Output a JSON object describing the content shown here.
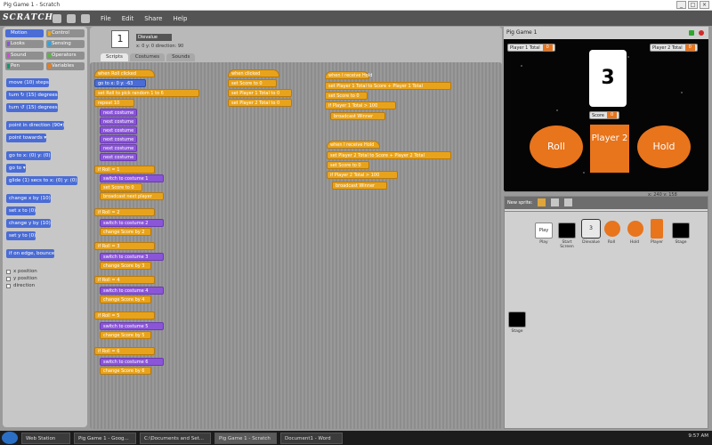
{
  "window": {
    "title": "Pig Game 1 - Scratch"
  },
  "menubar": {
    "logo": "SCRATCH",
    "items": [
      "File",
      "Edit",
      "Share",
      "Help"
    ]
  },
  "palette": {
    "categories": [
      {
        "label": "Motion",
        "color": "#4a6cd4"
      },
      {
        "label": "Control",
        "color": "#e8a31c"
      },
      {
        "label": "Looks",
        "color": "#8a55d7"
      },
      {
        "label": "Sensing",
        "color": "#2ca5e2"
      },
      {
        "label": "Sound",
        "color": "#cf4ad9"
      },
      {
        "label": "Operators",
        "color": "#5bb544"
      },
      {
        "label": "Pen",
        "color": "#0e9a6c"
      },
      {
        "label": "Variables",
        "color": "#ee7d16"
      }
    ],
    "blocks": [
      "move (10) steps",
      "turn ↻ (15) degrees",
      "turn ↺ (15) degrees",
      "point in direction (90▾)",
      "point towards ▾",
      "go to x: (0) y: (0)",
      "go to ▾",
      "glide (1) secs to x: (0) y: (0)",
      "change x by (10)",
      "set x to (0)",
      "change y by (10)",
      "set y to (0)",
      "if on edge, bounce"
    ],
    "checks": [
      "x position",
      "y position",
      "direction"
    ]
  },
  "sprite_header": {
    "number": "1",
    "name": "Dievalue",
    "info": "x: 0 y: 0 direction: 90"
  },
  "tabs": [
    "Scripts",
    "Costumes",
    "Sounds"
  ],
  "scripts": {
    "col1": [
      "when Roll clicked",
      "go to x: 0 y: -63",
      "set Roll to pick random 1 to 6",
      "repeat 10",
      "next costume",
      "next costume",
      "next costume",
      "next costume",
      "next costume",
      "next costume",
      "if Roll = 1",
      "switch to costume 1",
      "set Score to 0",
      "broadcast next player",
      "if Roll = 2",
      "switch to costume 2",
      "change Score by 2",
      "if Roll = 3",
      "switch to costume 3",
      "change Score by 3",
      "if Roll = 4",
      "switch to costume 4",
      "change Score by 4",
      "if Roll = 5",
      "switch to costume 5",
      "change Score by 5",
      "if Roll = 6",
      "switch to costume 6",
      "change Score by 6"
    ],
    "col2": [
      "when clicked",
      "set Score to 0",
      "set Player 1 Total to 0",
      "set Player 2 Total to 0"
    ],
    "col3": [
      "when I receive Hold",
      "set Player 1 Total to Score + Player 1 Total",
      "set Score to 0",
      "if Player 1 Total > 100",
      "broadcast Winner",
      "when I receive Hold",
      "set Player 2 Total to Score + Player 2 Total",
      "set Score to 0",
      "if Player 2 Total > 100",
      "broadcast Winner"
    ]
  },
  "stage": {
    "title": "Pig Game 1",
    "p1_label": "Player 1 Total",
    "p1_value": "0",
    "p2_label": "Player 2 Total",
    "p2_value": "0",
    "die_value": "3",
    "score_label": "Score",
    "score_value": "0",
    "roll_label": "Roll",
    "player_box": "Player 2",
    "hold_label": "Hold",
    "coords": "x: 240  y: 158"
  },
  "sprites": {
    "toolbar": [
      "New sprite:"
    ],
    "items": [
      "Play",
      "Start Screen",
      "Dievalue",
      "Roll",
      "Hold",
      "Player",
      "Stage"
    ],
    "stage_label": "Stage"
  },
  "taskbar": {
    "items": [
      "Web Station",
      "Pig Game 1 - Goog...",
      "C:\\Documents and Set...",
      "Pig Game 1 - Scratch",
      "Document1 - Word"
    ],
    "clock": "9:57 AM"
  }
}
